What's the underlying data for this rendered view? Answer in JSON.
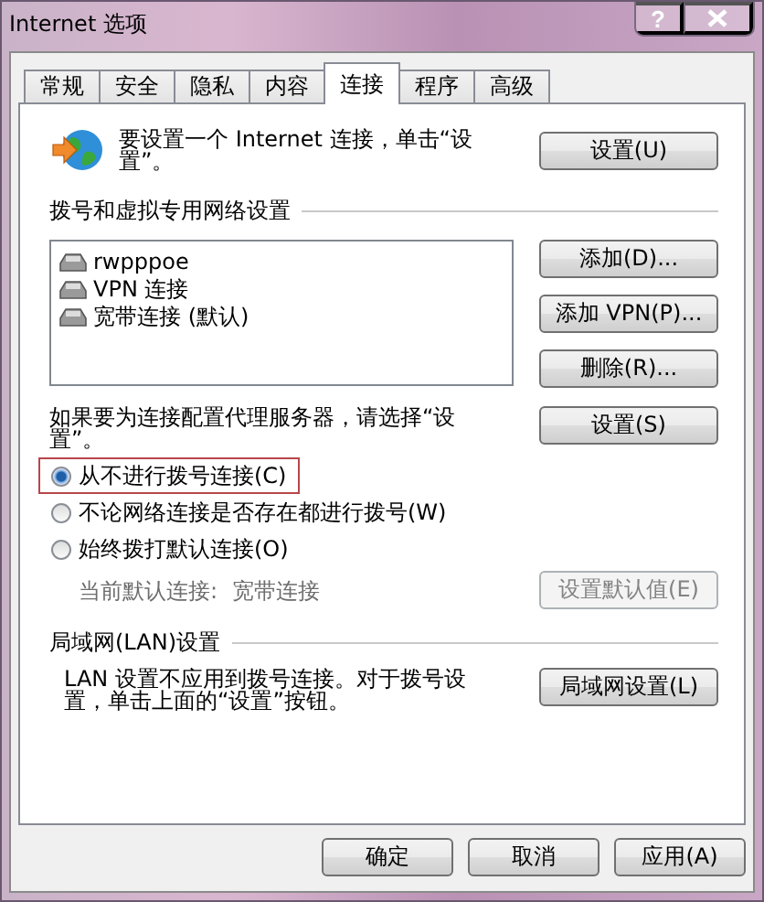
{
  "window": {
    "title": "Internet 选项",
    "help": "?"
  },
  "tabs": [
    {
      "label": "常规",
      "selected": false
    },
    {
      "label": "安全",
      "selected": false
    },
    {
      "label": "隐私",
      "selected": false
    },
    {
      "label": "内容",
      "selected": false
    },
    {
      "label": "连接",
      "selected": true
    },
    {
      "label": "程序",
      "selected": false
    },
    {
      "label": "高级",
      "selected": false
    }
  ],
  "setup": {
    "text": "要设置一个 Internet 连接，单击“设置”。",
    "button": "设置(U)"
  },
  "dialup": {
    "heading": "拨号和虚拟专用网络设置",
    "connections": [
      "rwpppoe",
      "VPN 连接",
      "宽带连接 (默认)"
    ],
    "buttons": [
      "添加(D)...",
      "添加 VPN(P)...",
      "删除(R)..."
    ],
    "proxy_text": "如果要为连接配置代理服务器，请选择“设置”。",
    "proxy_button": "设置(S)",
    "options": [
      {
        "label": "从不进行拨号连接(C)",
        "selected": true,
        "highlighted": true
      },
      {
        "label": "不论网络连接是否存在都进行拨号(W)",
        "selected": false,
        "highlighted": false
      },
      {
        "label": "始终拨打默认连接(O)",
        "selected": false,
        "highlighted": false
      }
    ],
    "current_label": "当前默认连接:",
    "current_value": "宽带连接",
    "default_button": {
      "label": "设置默认值(E)",
      "disabled": true
    }
  },
  "lan": {
    "heading": "局域网(LAN)设置",
    "text": "LAN 设置不应用到拨号连接。对于拨号设置，单击上面的“设置”按钮。",
    "button": "局域网设置(L)"
  },
  "footer": [
    "确定",
    "取消",
    "应用(A)"
  ]
}
